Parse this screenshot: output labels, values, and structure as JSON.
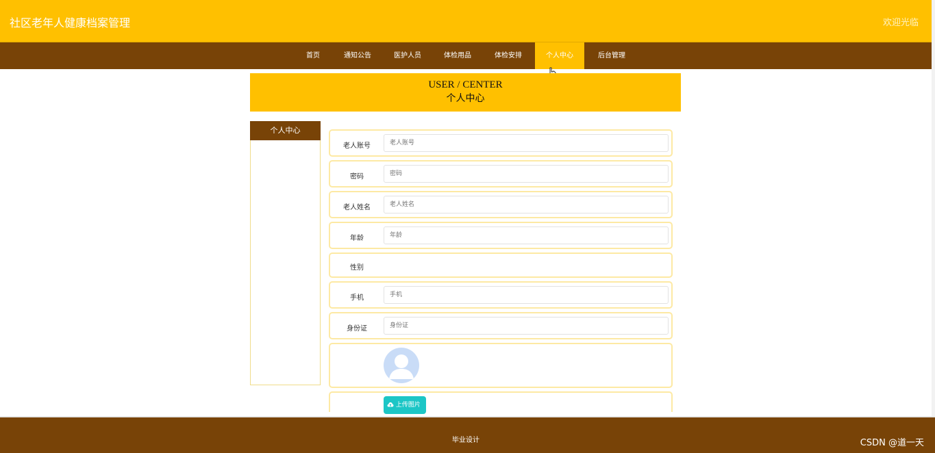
{
  "header": {
    "title": "社区老年人健康档案管理",
    "welcome": "欢迎光临"
  },
  "nav": {
    "items": [
      {
        "label": "首页"
      },
      {
        "label": "通知公告"
      },
      {
        "label": "医护人员"
      },
      {
        "label": "体检用品"
      },
      {
        "label": "体检安排"
      },
      {
        "label": "个人中心"
      },
      {
        "label": "后台管理"
      }
    ],
    "active": "个人中心"
  },
  "banner": {
    "en": "USER / CENTER",
    "cn": "个人中心"
  },
  "sidebar": {
    "title": "个人中心"
  },
  "form": {
    "account": {
      "label": "老人账号",
      "placeholder": "老人账号"
    },
    "password": {
      "label": "密码",
      "placeholder": "密码"
    },
    "name": {
      "label": "老人姓名",
      "placeholder": "老人姓名"
    },
    "age": {
      "label": "年龄",
      "placeholder": "年龄"
    },
    "gender": {
      "label": "性别"
    },
    "phone": {
      "label": "手机",
      "placeholder": "手机"
    },
    "idcard": {
      "label": "身份证",
      "placeholder": "身份证"
    },
    "upload_label": "上传图片"
  },
  "footer": {
    "text": "毕业设计"
  },
  "watermark": "CSDN @道一天",
  "colors": {
    "accent": "#ffc000",
    "nav": "#784307",
    "upload": "#1cc6c6"
  },
  "icons": {
    "upload": "cloud-upload-icon",
    "avatar": "avatar-placeholder-icon",
    "cursor": "hand-pointer-icon"
  }
}
